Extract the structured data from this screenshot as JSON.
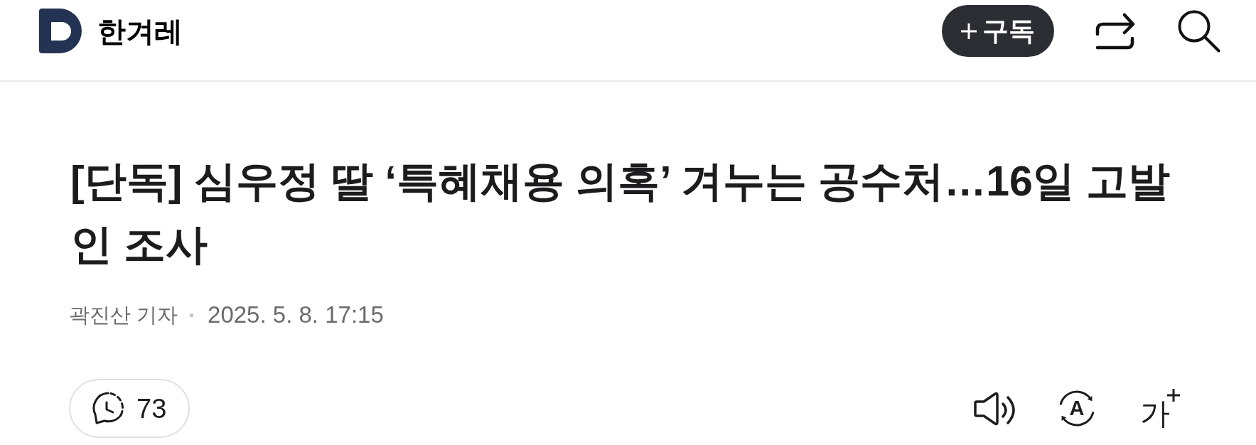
{
  "header": {
    "logo_text": "한겨레",
    "subscribe_button": {
      "label": "구독"
    }
  },
  "article": {
    "title": "[단독] 심우정 딸 ‘특혜채용 의혹’ 겨누는 공수처…16일 고발인 조사",
    "byline": "곽진산 기자",
    "date": "2025. 5. 8. 17:15"
  },
  "toolbar": {
    "comment_count": "73",
    "translate_label": "A",
    "font_size_label": "가"
  }
}
